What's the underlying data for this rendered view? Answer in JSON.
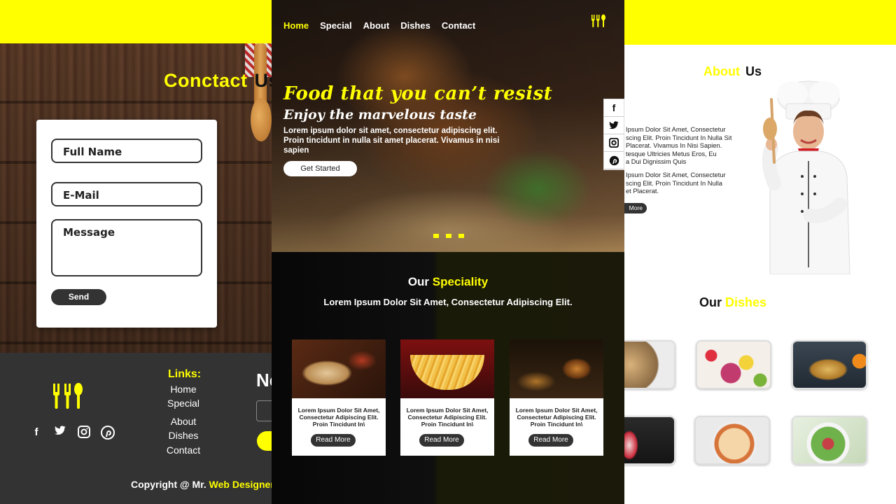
{
  "contact_page": {
    "title_highlight": "Conctact",
    "title_rest": "Us",
    "form": {
      "name_placeholder": "Full Name",
      "email_placeholder": "E-Mail",
      "message_placeholder": "Message",
      "send_label": "Send"
    },
    "footer": {
      "links_title": "Links:",
      "links": [
        "Home",
        "Special",
        "About",
        "Dishes",
        "Contact"
      ],
      "social_icons": [
        "facebook-icon",
        "twitter-icon",
        "instagram-icon",
        "pinterest-icon"
      ],
      "newsletter_title": "New",
      "copyright_prefix": "Copyright @ Mr.",
      "copyright_highlight": "Web Designer"
    }
  },
  "home_page": {
    "nav": {
      "items": [
        "Home",
        "Special",
        "About",
        "Dishes",
        "Contact"
      ],
      "active": "Home"
    },
    "hero": {
      "title": "Food that you can’t resist",
      "subtitle": "Enjoy the marvelous taste",
      "text": "Lorem ipsum dolor sit amet, consectetur adipiscing elit. Proin tincidunt in nulla sit amet placerat. Vivamus in nisi sapien",
      "cta_label": "Get Started",
      "slide_count": 3
    },
    "social_sidebar": [
      "facebook-icon",
      "twitter-icon",
      "instagram-icon",
      "pinterest-icon"
    ],
    "speciality": {
      "title_prefix": "Our",
      "title_highlight": "Speciality",
      "subtitle": "Lorem Ipsum Dolor Sit Amet, Consectetur Adipiscing Elit.",
      "cards": [
        {
          "image": "burrito",
          "text": "Lorem Ipsum Dolor Sit Amet, Consectetur Adipiscing Elit. Proin Tincidunt In\\",
          "button": "Read More"
        },
        {
          "image": "fries",
          "text": "Lorem Ipsum Dolor Sit Amet, Consectetur Adipiscing Elit. Proin Tincidunt In\\",
          "button": "Read More"
        },
        {
          "image": "burger",
          "text": "Lorem Ipsum Dolor Sit Amet, Consectetur Adipiscing Elit. Proin Tincidunt In\\",
          "button": "Read More"
        }
      ]
    }
  },
  "about_page": {
    "title_highlight": "About",
    "title_rest": "Us",
    "paragraph_1": "Ipsum Dolor Sit Amet, Consectetur\nscing Elit. Proin Tincidunt In Nulla Sit\nPlacerat. Vivamus In Nisi Sapien.\ntesque Ultricies Metus Eros, Eu\na Dui Dignissim Quis",
    "paragraph_2": "Ipsum Dolor Sit Amet, Consectetur\nscing Elit. Proin Tincidunt In Nulla\net Placerat.",
    "button_label": "More",
    "dishes_title_prefix": "Our",
    "dishes_title_highlight": "Dishes",
    "dishes": [
      "pasta",
      "fruit-bowl",
      "spaghetti",
      "parfait",
      "noodle-soup",
      "salad"
    ]
  },
  "colors": {
    "accent": "#ffff00",
    "dark": "#333333",
    "background_dark": "#0e0e0e"
  }
}
